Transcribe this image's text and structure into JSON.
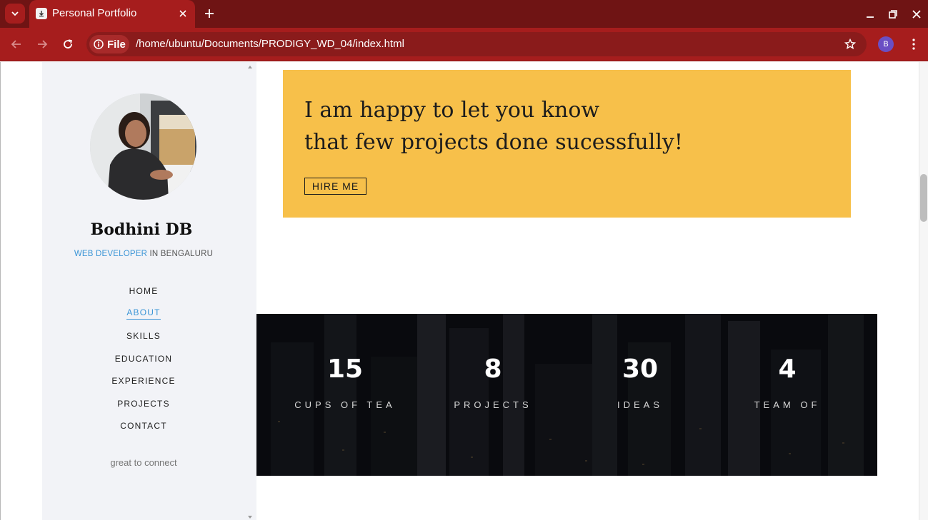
{
  "browser": {
    "tab_title": "Personal Portfolio",
    "site_chip": "File",
    "url": "/home/ubuntu/Documents/PRODIGY_WD_04/index.html",
    "profile_initial": "B",
    "colors": {
      "tabbar": "#6f1414",
      "toolbar": "#a61d1d",
      "omnibox": "#8a1b1b"
    }
  },
  "sidebar": {
    "name": "Bodhini DB",
    "role_accent": "WEB DEVELOPER",
    "role_rest": " IN BENGALURU",
    "nav": [
      {
        "label": "HOME"
      },
      {
        "label": "ABOUT",
        "active": true
      },
      {
        "label": "SKILLS"
      },
      {
        "label": "EDUCATION"
      },
      {
        "label": "EXPERIENCE"
      },
      {
        "label": "PROJECTS"
      },
      {
        "label": "CONTACT"
      }
    ],
    "footer": "great to connect"
  },
  "hire": {
    "line1": "I am happy to let you know",
    "line2": "that few projects done sucessfully!",
    "button": "HIRE ME",
    "color": "#f7c04a"
  },
  "stats": [
    {
      "value": "15",
      "label": "CUPS OF TEA"
    },
    {
      "value": "8",
      "label": "PROJECTS"
    },
    {
      "value": "30",
      "label": "IDEAS"
    },
    {
      "value": "4",
      "label": "TEAM OF"
    }
  ],
  "icons": {
    "tab_menu": "chevron-down-icon",
    "favicon": "file-icon",
    "tab_close": "close-icon",
    "new_tab": "plus-icon",
    "back": "arrow-left-icon",
    "forward": "arrow-right-icon",
    "reload": "reload-icon",
    "info": "info-icon",
    "bookmark": "star-icon",
    "menu": "kebab-icon"
  }
}
